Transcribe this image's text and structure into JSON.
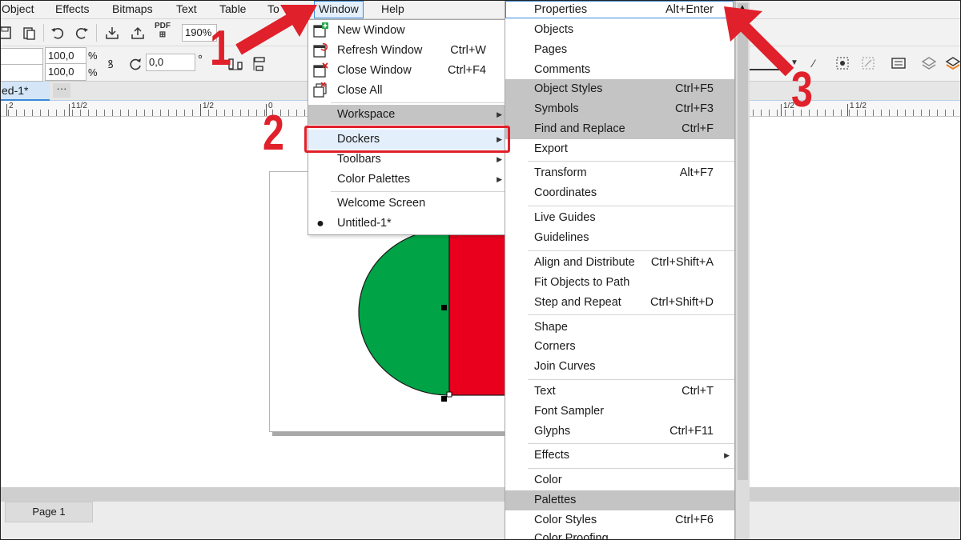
{
  "menubar": {
    "items": [
      "Object",
      "Effects",
      "Bitmaps",
      "Text",
      "Table",
      "To",
      "Window",
      "Help"
    ]
  },
  "toolbar": {
    "zoom": "190%",
    "pdf_label": "PDF",
    "scale_x": "100,0",
    "scale_y": "100,0",
    "percent": "%",
    "rotation": "0,0",
    "degree": "°"
  },
  "document": {
    "tab_title": "ed-1*",
    "more": "···",
    "page_tab": "Page 1"
  },
  "ruler": {
    "labels": [
      "2",
      "1",
      "1/2",
      "1/2",
      "0",
      "1/2",
      "1",
      "1/2"
    ]
  },
  "window_menu": {
    "items": [
      {
        "label": "New Window",
        "shortcut": ""
      },
      {
        "label": "Refresh Window",
        "shortcut": "Ctrl+W"
      },
      {
        "label": "Close Window",
        "shortcut": "Ctrl+F4"
      },
      {
        "label": "Close All",
        "shortcut": ""
      },
      {
        "label": "Workspace",
        "shortcut": ""
      },
      {
        "label": "Dockers",
        "shortcut": ""
      },
      {
        "label": "Toolbars",
        "shortcut": ""
      },
      {
        "label": "Color Palettes",
        "shortcut": ""
      },
      {
        "label": "Welcome Screen",
        "shortcut": ""
      },
      {
        "label": "Untitled-1*",
        "shortcut": ""
      }
    ]
  },
  "dockers_menu": {
    "items": [
      {
        "label": "Properties",
        "shortcut": "Alt+Enter"
      },
      {
        "label": "Objects",
        "shortcut": ""
      },
      {
        "label": "Pages",
        "shortcut": ""
      },
      {
        "label": "Comments",
        "shortcut": ""
      },
      {
        "label": "Object Styles",
        "shortcut": "Ctrl+F5"
      },
      {
        "label": "Symbols",
        "shortcut": "Ctrl+F3"
      },
      {
        "label": "Find and Replace",
        "shortcut": "Ctrl+F"
      },
      {
        "label": "Export",
        "shortcut": ""
      },
      {
        "label": "Transform",
        "shortcut": "Alt+F7"
      },
      {
        "label": "Coordinates",
        "shortcut": ""
      },
      {
        "label": "Live Guides",
        "shortcut": ""
      },
      {
        "label": "Guidelines",
        "shortcut": ""
      },
      {
        "label": "Align and Distribute",
        "shortcut": "Ctrl+Shift+A"
      },
      {
        "label": "Fit Objects to Path",
        "shortcut": ""
      },
      {
        "label": "Step and Repeat",
        "shortcut": "Ctrl+Shift+D"
      },
      {
        "label": "Shape",
        "shortcut": ""
      },
      {
        "label": "Corners",
        "shortcut": ""
      },
      {
        "label": "Join Curves",
        "shortcut": ""
      },
      {
        "label": "Text",
        "shortcut": "Ctrl+T"
      },
      {
        "label": "Font Sampler",
        "shortcut": ""
      },
      {
        "label": "Glyphs",
        "shortcut": "Ctrl+F11"
      },
      {
        "label": "Effects",
        "shortcut": ""
      },
      {
        "label": "Color",
        "shortcut": ""
      },
      {
        "label": "Palettes",
        "shortcut": ""
      },
      {
        "label": "Color Styles",
        "shortcut": "Ctrl+F6"
      },
      {
        "label": "Color Proofing",
        "shortcut": ""
      }
    ]
  },
  "annotations": {
    "step1": "1",
    "step2": "2",
    "step3": "3"
  },
  "colors": {
    "accent": "#3c88d8",
    "annotation_red": "#e0202a",
    "shape_green": "#00a346",
    "shape_red": "#e8001c",
    "menu_gray": "#c4c4c4"
  }
}
